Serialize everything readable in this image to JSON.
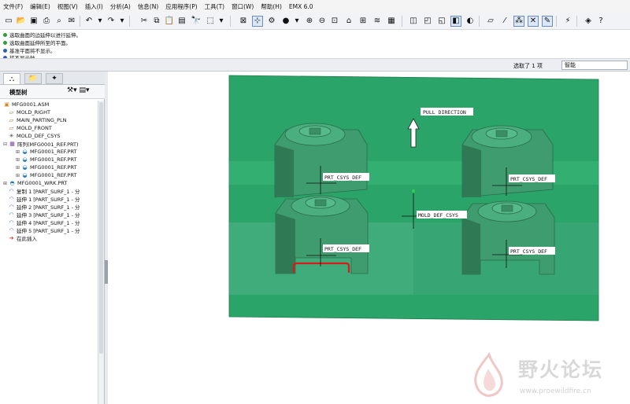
{
  "menubar": {
    "items": [
      "文件(F)",
      "编辑(E)",
      "视图(V)",
      "插入(I)",
      "分析(A)",
      "信息(N)",
      "应用程序(P)",
      "工具(T)",
      "窗口(W)",
      "帮助(H)",
      "EMX 6.0"
    ]
  },
  "messages": [
    {
      "text": "选取曲面的边延伸以进行延伸。",
      "color": "#2e9d3a"
    },
    {
      "text": "选取曲面延伸所至的平面。",
      "color": "#2e9d3a"
    },
    {
      "text": "基准平面将不显示。",
      "color": "#2d62b0"
    },
    {
      "text": "将不显示轴。",
      "color": "#2d62b0"
    }
  ],
  "status": {
    "selected_label": "选取了 1 项",
    "filter_value": "智能"
  },
  "model_tree": {
    "title": "模型树",
    "items": [
      {
        "label": "MFG0001.ASM",
        "icon": "assembly-icon"
      },
      {
        "label": "MOLD_RIGHT",
        "icon": "datum-plane-icon"
      },
      {
        "label": "MAIN_PARTING_PLN",
        "icon": "datum-plane-icon"
      },
      {
        "label": "MOLD_FRONT",
        "icon": "datum-plane-icon"
      },
      {
        "label": "MOLD_DEF_CSYS",
        "icon": "csys-icon"
      },
      {
        "label": "阵列(MFG0001_REF.PRT)",
        "icon": "pattern-icon"
      },
      {
        "label": "MFG0001_REF.PRT",
        "icon": "part-icon"
      },
      {
        "label": "MFG0001_REF.PRT",
        "icon": "part-icon"
      },
      {
        "label": "MFG0001_REF.PRT",
        "icon": "part-icon"
      },
      {
        "label": "MFG0001_REF.PRT",
        "icon": "part-icon"
      },
      {
        "label": "MFG0001_WRK.PRT",
        "icon": "workpiece-icon"
      },
      {
        "label": "复制 1 [PART_SURF_1 - 分",
        "icon": "surface-icon"
      },
      {
        "label": "延伸 1 [PART_SURF_1 - 分",
        "icon": "surface-icon"
      },
      {
        "label": "延伸 2 [PART_SURF_1 - 分",
        "icon": "surface-icon"
      },
      {
        "label": "延伸 3 [PART_SURF_1 - 分",
        "icon": "surface-icon"
      },
      {
        "label": "延伸 4 [PART_SURF_1 - 分",
        "icon": "surface-icon"
      },
      {
        "label": "延伸 5 [PART_SURF_1 - 分",
        "icon": "surface-icon"
      },
      {
        "label": "在此插入",
        "icon": "insert-here-icon"
      }
    ]
  },
  "viewport": {
    "pull_direction_label": "PULL DIRECTION",
    "mold_csys_label": "MOLD_DEF_CSYS",
    "part_csys_labels": [
      "PRT_CSYS_DEF",
      "PRT_CSYS_DEF",
      "PRT_CSYS_DEF",
      "PRT_CSYS_DEF"
    ],
    "colors": {
      "mold": "#2aa468",
      "mold_light": "#39b878",
      "part": "#3f9c6e",
      "part_shade": "#2f7a55",
      "selected_edge": "#d81a1a"
    }
  },
  "watermark": {
    "title": "野火论坛",
    "url": "www.proewildfire.cn"
  }
}
